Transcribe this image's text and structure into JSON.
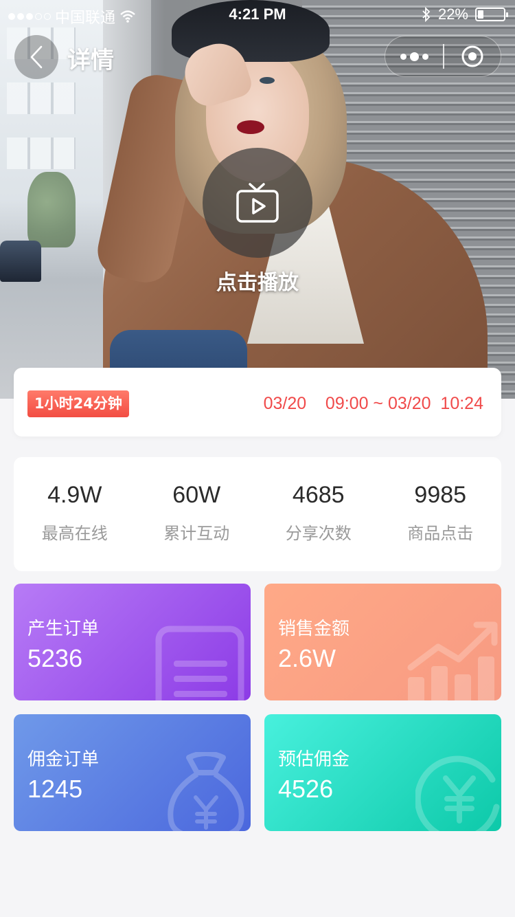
{
  "status_bar": {
    "carrier": "中国联通",
    "time": "4:21 PM",
    "battery_text": "22%",
    "battery_level": 0.22
  },
  "nav": {
    "title": "详情",
    "back_icon": "chevron-left-icon",
    "more_icon": "more-dots-icon",
    "close_icon": "target-close-icon"
  },
  "cover": {
    "play_label": "点击播放",
    "play_icon": "tv-play-icon"
  },
  "live_time": {
    "duration": "1小时24分钟",
    "range": "03/20    09:00 ~ 03/20  10:24",
    "accent_color": "#f04a4a"
  },
  "stats": [
    {
      "value": "4.9W",
      "label": "最高在线"
    },
    {
      "value": "60W",
      "label": "累计互动"
    },
    {
      "value": "4685",
      "label": "分享次数"
    },
    {
      "value": "9985",
      "label": "商品点击"
    }
  ],
  "metrics": [
    {
      "label": "产生订单",
      "value": "5236",
      "icon": "document-icon",
      "color": "#9b51ec"
    },
    {
      "label": "销售金额",
      "value": "2.6W",
      "icon": "trend-chart-icon",
      "color": "#f9a084"
    },
    {
      "label": "佣金订单",
      "value": "1245",
      "icon": "money-bag-icon",
      "color": "#5a7fe2"
    },
    {
      "label": "预估佣金",
      "value": "4526",
      "icon": "yen-coin-icon",
      "color": "#1fd8bf"
    }
  ]
}
